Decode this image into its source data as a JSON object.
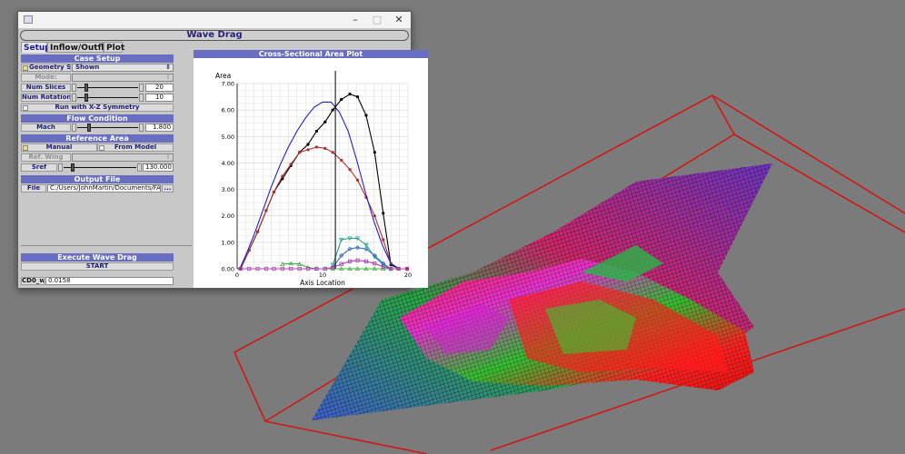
{
  "window": {
    "title": "Wave Drag",
    "controls": {
      "minimize": "–",
      "maximize": "□",
      "close": "✕"
    }
  },
  "tabs": [
    "Setup",
    "Inflow/Outflow",
    "Plot"
  ],
  "case_setup": {
    "header": "Case Setup",
    "geometry_set_label": "Geometry Set:",
    "geometry_set_value": "Shown",
    "mode_label": "Mode:",
    "num_slices_label": "Num Slices",
    "num_slices_value": "20",
    "num_slices_level": 0.12,
    "num_rotations_label": "Num Rotations",
    "num_rotations_value": "10",
    "num_rotations_level": 0.12,
    "symmetry_label": "Run with X-Z Symmetry"
  },
  "flow_condition": {
    "header": "Flow Condition",
    "mach_label": "Mach",
    "mach_value": "1.800",
    "mach_level": 0.18
  },
  "reference_area": {
    "header": "Reference Area",
    "manual_label": "Manual",
    "from_model_label": "From Model",
    "ref_wing_label": "Ref. Wing",
    "sref_label": "Sref",
    "sref_value": "130.000",
    "sref_level": 0.1
  },
  "output_file": {
    "header": "Output File",
    "file_label": "File",
    "file_path": "C:/Users/JohnMartin/Documents/FAXX/",
    "browse_label": "..."
  },
  "execute": {
    "header": "Execute Wave Drag",
    "start_label": "START"
  },
  "result": {
    "label": "CD0_w",
    "value": "0.0158"
  },
  "plot_panel": {
    "header": "Cross-Sectional Area Plot"
  },
  "chart_data": {
    "type": "line",
    "title": "",
    "xlabel": "Axis Location",
    "ylabel": "Area",
    "xlim": [
      0,
      20
    ],
    "ylim": [
      0,
      7
    ],
    "xticks": [
      0,
      10,
      20
    ],
    "yticks": [
      "0.00",
      "1.00",
      "2.00",
      "3.00",
      "4.00",
      "5.00",
      "6.00",
      "7.00"
    ],
    "grid": true,
    "vline_x": 11.5,
    "series": [
      {
        "color": "#000000",
        "marker": "circle",
        "x": [
          0.4,
          1.4,
          2.4,
          3.4,
          4.3,
          5.3,
          6.3,
          7.3,
          8.3,
          9.3,
          10.3,
          11.2,
          12.2,
          13.2,
          14.1,
          15.1,
          16.1,
          17.1,
          18.0,
          18.9,
          19.9
        ],
        "y": [
          0,
          0.7,
          1.4,
          2.2,
          2.9,
          3.4,
          3.9,
          4.4,
          4.7,
          5.2,
          5.55,
          6.0,
          6.4,
          6.6,
          6.5,
          5.8,
          4.4,
          2.1,
          0.15,
          0,
          0
        ]
      },
      {
        "color": "#b03030",
        "marker": "circle",
        "x": [
          0.4,
          1.4,
          2.4,
          3.4,
          4.3,
          5.3,
          6.3,
          7.3,
          8.3,
          9.3,
          10.3,
          11.2,
          12.2,
          13.2,
          14.1,
          15.1,
          16.1,
          17.1,
          18.0,
          18.9,
          19.9
        ],
        "y": [
          0,
          0.7,
          1.4,
          2.2,
          2.9,
          3.5,
          3.95,
          4.4,
          4.5,
          4.6,
          4.55,
          4.4,
          4.1,
          3.75,
          3.35,
          2.7,
          2.0,
          1.1,
          0.2,
          0,
          0
        ]
      },
      {
        "color": "#2020d0",
        "marker": "none",
        "x": [
          0.3,
          1,
          2,
          3,
          4,
          5,
          6,
          7,
          8,
          9,
          10,
          11,
          12,
          13,
          14,
          15,
          16,
          17,
          18,
          19,
          19.9
        ],
        "y": [
          0,
          0.5,
          1.3,
          2.2,
          3.1,
          3.9,
          4.6,
          5.2,
          5.7,
          6.1,
          6.3,
          6.3,
          5.9,
          5.2,
          4.1,
          2.9,
          1.8,
          0.9,
          0.2,
          0,
          0
        ]
      },
      {
        "color": "#2aa58c",
        "marker": "triangle-down",
        "x": [
          11.2,
          12.2,
          13.2,
          14.1,
          15.1,
          16.1,
          17.1,
          18.0
        ],
        "y": [
          0.15,
          1.1,
          1.15,
          1.15,
          0.9,
          0.45,
          0.15,
          0
        ]
      },
      {
        "color": "#3b6fc0",
        "marker": "diamond",
        "x": [
          11.2,
          12.2,
          13.2,
          14.1,
          15.1,
          16.1,
          17.1,
          18.0
        ],
        "y": [
          0.05,
          0.5,
          0.75,
          0.8,
          0.75,
          0.5,
          0.2,
          0
        ]
      },
      {
        "color": "#40b040",
        "marker": "triangle-up",
        "x": [
          5.3,
          6.3,
          7.3,
          8.3,
          9.3,
          10.3,
          11.2,
          12.2,
          13.2,
          14.1,
          15.1,
          16.1,
          17.1,
          18.0,
          18.9
        ],
        "y": [
          0.18,
          0.2,
          0.18,
          0.05,
          0,
          0,
          0,
          0,
          0,
          0,
          0,
          0,
          0,
          0,
          0
        ]
      },
      {
        "color": "#b040b0",
        "marker": "square",
        "x": [
          0.4,
          1.4,
          2.4,
          3.4,
          4.3,
          5.3,
          6.3,
          7.3,
          8.3,
          9.3,
          10.3,
          11.2,
          12.2,
          13.2,
          14.1,
          15.1,
          16.1,
          17.1,
          18.0,
          18.9,
          19.9
        ],
        "y": [
          0,
          0,
          0,
          0,
          0,
          0,
          0,
          0,
          0,
          0,
          0,
          0.05,
          0.18,
          0.28,
          0.32,
          0.28,
          0.2,
          0.08,
          0,
          0,
          0
        ]
      }
    ]
  }
}
